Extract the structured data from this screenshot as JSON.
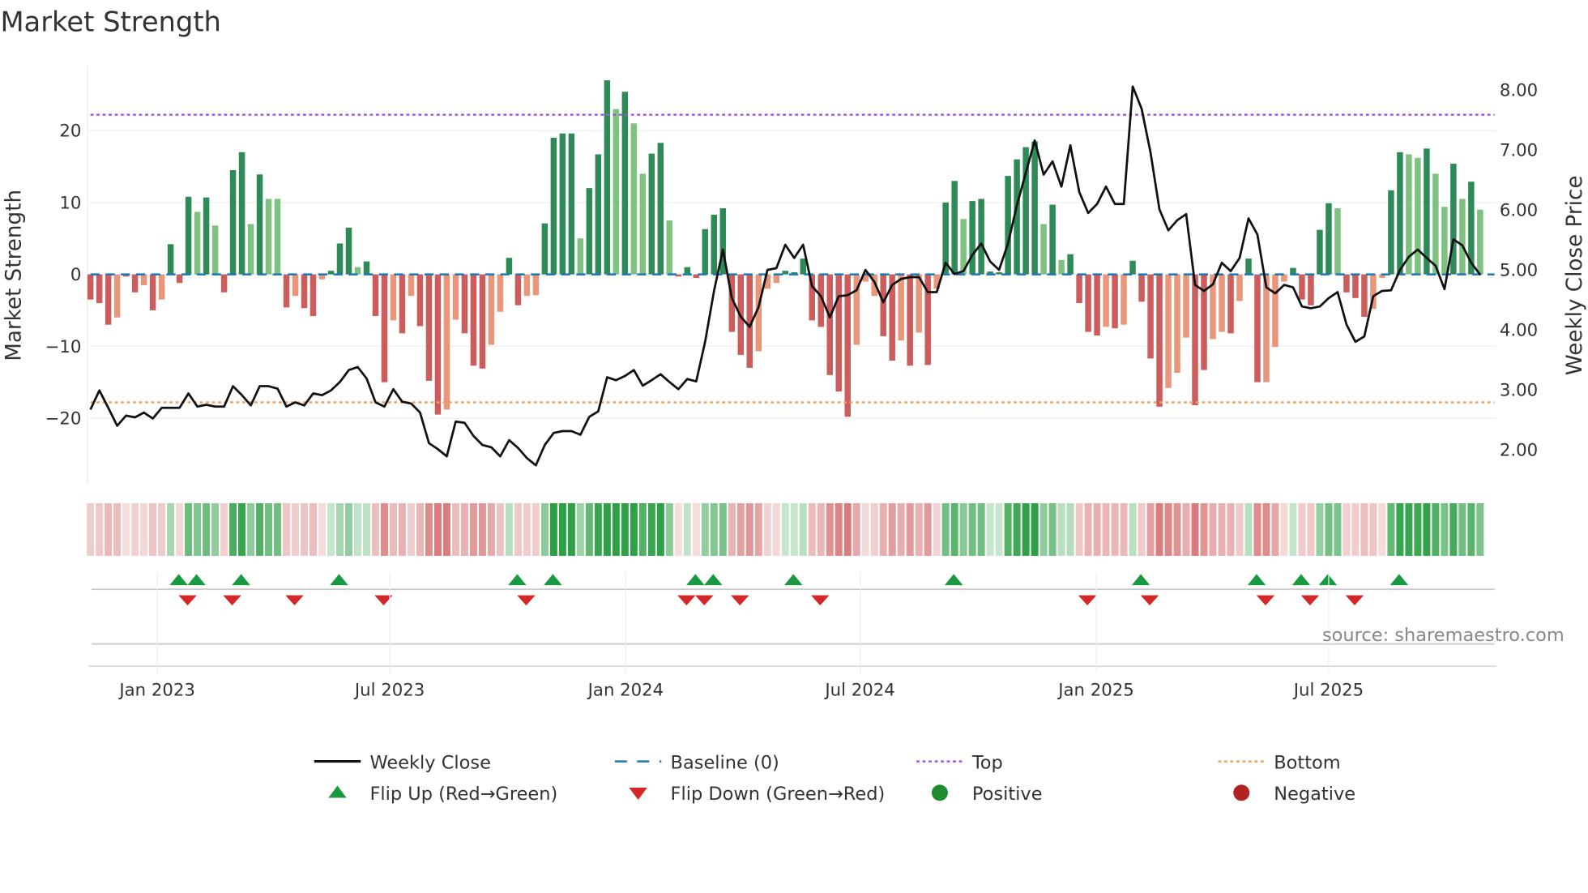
{
  "chart_data": {
    "type": "bar",
    "title": "Market Strength",
    "ylabel": "Market Strength",
    "y2label": "Weekly Close Price",
    "ylim": [
      -28,
      28.5
    ],
    "y2lim": [
      1.56,
      8.62
    ],
    "yticks": [
      {
        "v": 20,
        "label": "20"
      },
      {
        "v": 10,
        "label": "10"
      },
      {
        "v": 0,
        "label": "0"
      },
      {
        "v": -10,
        "label": "−10"
      },
      {
        "v": -20,
        "label": "−20"
      }
    ],
    "y2ticks": [
      {
        "v": 8,
        "label": "8.00"
      },
      {
        "v": 7,
        "label": "7.00"
      },
      {
        "v": 6,
        "label": "6.00"
      },
      {
        "v": 5,
        "label": "5.00"
      },
      {
        "v": 4,
        "label": "4.00"
      },
      {
        "v": 3,
        "label": "3.00"
      },
      {
        "v": 2,
        "label": "2.00"
      }
    ],
    "xticks": [
      {
        "week": 7.5,
        "label": "Jan 2023"
      },
      {
        "week": 33.6,
        "label": "Jul 2023"
      },
      {
        "week": 60.1,
        "label": "Jan 2024"
      },
      {
        "week": 86.4,
        "label": "Jul 2024"
      },
      {
        "week": 112.9,
        "label": "Jan 2025"
      },
      {
        "week": 139,
        "label": "Jul 2025"
      }
    ],
    "top": 22.2,
    "bottom": -17.8,
    "baseline": 0,
    "strength": [
      -3.5,
      -4,
      -7,
      -6,
      -0.3,
      -2.5,
      -1.5,
      -5,
      -3.5,
      4.2,
      -1.2,
      10.8,
      8.7,
      10.7,
      6.8,
      -2.5,
      14.5,
      17,
      7,
      13.9,
      10.5,
      10.5,
      -4.6,
      -3,
      -4.7,
      -5.8,
      -0.7,
      0.5,
      4.3,
      6.5,
      1,
      1.8,
      -5.8,
      -15,
      -6.4,
      -8.2,
      -3,
      -7.2,
      -14.8,
      -19.5,
      -18.8,
      -6.3,
      -8.2,
      -12.7,
      -13.1,
      -9.8,
      -5.2,
      2.3,
      -4.3,
      -3,
      -2.9,
      7.1,
      19,
      19.6,
      19.6,
      5,
      12,
      16.7,
      27,
      23,
      25.4,
      21,
      14,
      16.8,
      18.3,
      7.5,
      -0.3,
      1,
      -0.5,
      6.3,
      8.3,
      9.2,
      -8,
      -11.2,
      -13,
      -10.7,
      -2,
      -1.2,
      0.5,
      0.3,
      2.2,
      -6.4,
      -7.3,
      -14,
      -16.3,
      -19.8,
      -9.8,
      -1,
      -3,
      -8.6,
      -12,
      -9.2,
      -12.7,
      -8.1,
      -12.6,
      -2,
      10,
      13,
      7.7,
      10.2,
      10.5,
      0.4,
      0.3,
      13.7,
      16,
      17.7,
      18.5,
      7,
      9.7,
      2,
      2.8,
      -4,
      -8,
      -8.5,
      -7.3,
      -7.5,
      -7,
      1.9,
      -3.8,
      -11.7,
      -18.4,
      -15.8,
      -13.7,
      -8.8,
      -18.2,
      -13.3,
      -9,
      -8,
      -8.2,
      -3.7,
      2.2,
      -15,
      -15,
      -10.1,
      -1,
      0.9,
      -3.5,
      -4.3,
      6.2,
      9.9,
      9.2,
      -2.5,
      -3.3,
      -5.9,
      -4.8,
      -0.5,
      11.7,
      17,
      16.7,
      16.2,
      17.5,
      14,
      9.4,
      15.4,
      10.5,
      12.9,
      9
    ],
    "light": [
      0,
      0,
      0,
      1,
      0,
      0,
      1,
      0,
      1,
      0,
      0,
      0,
      1,
      0,
      1,
      0,
      0,
      0,
      1,
      0,
      1,
      1,
      0,
      1,
      0,
      0,
      1,
      0,
      0,
      0,
      1,
      0,
      0,
      0,
      1,
      0,
      1,
      0,
      0,
      0,
      1,
      1,
      0,
      0,
      0,
      1,
      1,
      0,
      0,
      1,
      1,
      0,
      0,
      0,
      0,
      1,
      0,
      0,
      0,
      1,
      0,
      1,
      1,
      0,
      0,
      1,
      0,
      0,
      0,
      0,
      0,
      0,
      0,
      0,
      0,
      1,
      1,
      1,
      0,
      0,
      0,
      0,
      0,
      0,
      0,
      0,
      1,
      1,
      1,
      0,
      0,
      1,
      0,
      1,
      0,
      1,
      0,
      0,
      1,
      0,
      0,
      0,
      0,
      0,
      0,
      0,
      0,
      1,
      0,
      1,
      0,
      0,
      0,
      0,
      1,
      0,
      1,
      0,
      0,
      0,
      0,
      1,
      1,
      1,
      0,
      0,
      1,
      1,
      0,
      1,
      0,
      0,
      1,
      1,
      1,
      0,
      0,
      0,
      0,
      0,
      1,
      0,
      0,
      0,
      1,
      1,
      0,
      0,
      1,
      1,
      0,
      1,
      1,
      0,
      1,
      0,
      1
    ],
    "weekly_close": [
      2.67,
      2.99,
      2.7,
      2.4,
      2.57,
      2.54,
      2.62,
      2.52,
      2.7,
      2.7,
      2.7,
      2.94,
      2.72,
      2.75,
      2.72,
      2.72,
      3.06,
      2.91,
      2.74,
      3.06,
      3.06,
      3.02,
      2.72,
      2.79,
      2.74,
      2.94,
      2.91,
      2.99,
      3.13,
      3.33,
      3.38,
      3.19,
      2.79,
      2.72,
      3.01,
      2.8,
      2.77,
      2.62,
      2.11,
      2.01,
      1.89,
      2.47,
      2.45,
      2.23,
      2.08,
      2.04,
      1.89,
      2.16,
      2.03,
      1.86,
      1.74,
      2.08,
      2.28,
      2.31,
      2.31,
      2.25,
      2.55,
      2.64,
      3.21,
      3.16,
      3.23,
      3.33,
      3.07,
      3.16,
      3.26,
      3.13,
      3.01,
      3.18,
      3.14,
      3.8,
      4.65,
      5.34,
      4.53,
      4.22,
      4.05,
      4.38,
      5.0,
      5.03,
      5.42,
      5.2,
      5.42,
      4.73,
      4.56,
      4.21,
      4.56,
      4.58,
      4.66,
      5.0,
      4.8,
      4.46,
      4.75,
      4.85,
      4.88,
      4.88,
      4.63,
      4.63,
      5.12,
      4.93,
      4.98,
      5.25,
      5.44,
      5.14,
      5.0,
      5.44,
      6.08,
      6.62,
      7.16,
      6.59,
      6.81,
      6.39,
      7.08,
      6.3,
      5.95,
      6.1,
      6.39,
      6.1,
      6.1,
      8.06,
      7.69,
      6.96,
      6.01,
      5.66,
      5.83,
      5.93,
      4.75,
      4.65,
      4.76,
      5.12,
      4.98,
      5.2,
      5.86,
      5.59,
      4.71,
      4.61,
      4.75,
      4.71,
      4.39,
      4.36,
      4.39,
      4.53,
      4.63,
      4.09,
      3.8,
      3.89,
      4.56,
      4.65,
      4.66,
      5.0,
      5.22,
      5.34,
      5.2,
      5.07,
      4.68,
      5.51,
      5.41,
      5.12,
      4.92
    ],
    "flip_up_weeks": [
      9,
      11,
      16,
      27,
      47,
      51,
      67,
      69,
      78,
      96,
      117,
      130,
      135,
      138,
      146
    ],
    "flip_down_weeks": [
      10,
      15,
      22,
      32,
      48,
      66,
      68,
      72,
      81,
      111,
      118,
      131,
      136,
      141
    ],
    "legend": [
      {
        "key": "close",
        "label": "Weekly Close"
      },
      {
        "key": "baseline",
        "label": "Baseline (0)"
      },
      {
        "key": "top",
        "label": "Top"
      },
      {
        "key": "bottom",
        "label": "Bottom"
      },
      {
        "key": "flipup",
        "label": "Flip Up (Red→Green)"
      },
      {
        "key": "flipdown",
        "label": "Flip Down (Green→Red)"
      },
      {
        "key": "positive",
        "label": "Positive"
      },
      {
        "key": "negative",
        "label": "Negative"
      }
    ],
    "legend_placement": "bottom",
    "source": "source: sharemaestro.com",
    "colors": {
      "dark_green": "#2e8b57",
      "light_green": "#7fc27f",
      "dark_red": "#cd5c5c",
      "light_red": "#e9967a",
      "top": "#9b59e8",
      "bottom": "#f0a060",
      "baseline": "#1f77b4",
      "flip_up": "#1a9a40",
      "flip_down": "#d62728",
      "positive": "#1e8c2e",
      "negative": "#b22222"
    }
  }
}
